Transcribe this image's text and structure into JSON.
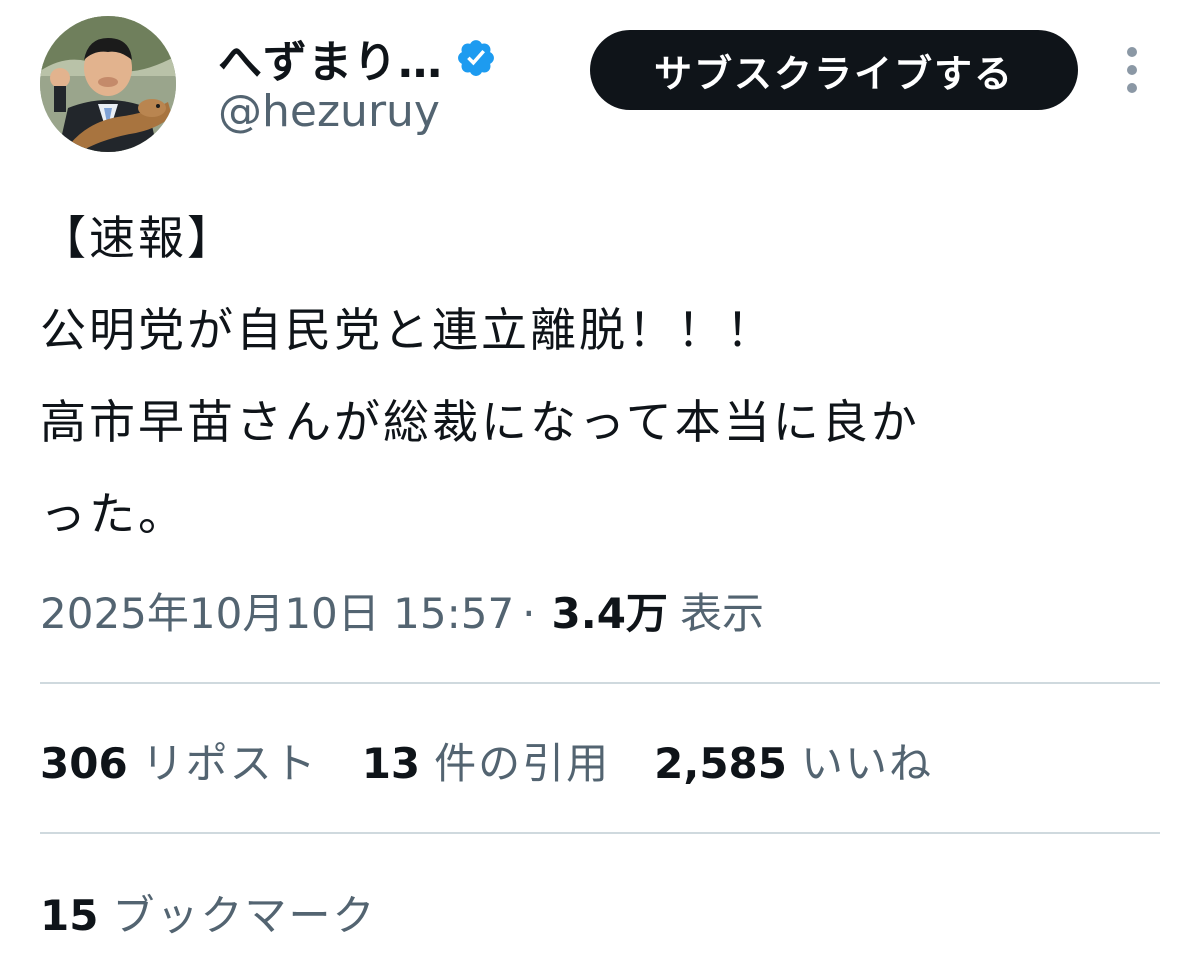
{
  "tweet": {
    "author": {
      "display_name": "へずまり…",
      "handle": "@hezuruy",
      "verified": true,
      "verified_icon": "verified-badge-icon"
    },
    "subscribe_label": "サブスクライブする",
    "more_icon": "more-vertical-icon",
    "text_lines": [
      "【速報】",
      "公明党が自民党と連立離脱！！！",
      "高市早苗さんが総裁になって本当に良か",
      "った。"
    ],
    "timestamp": "2025年10月10日 15:57",
    "separator": "·",
    "views_count": "3.4万",
    "views_label": "表示",
    "stats": [
      {
        "count": "306",
        "label": "リポスト"
      },
      {
        "count": "13",
        "label": "件の引用"
      },
      {
        "count": "2,585",
        "label": "いいね"
      }
    ],
    "bookmarks": {
      "count": "15",
      "label": "ブックマーク"
    }
  },
  "colors": {
    "text_primary": "#0f1419",
    "text_secondary": "#536471",
    "verified_blue": "#1d9bf0",
    "divider": "#cfd9de",
    "button_bg": "#0f1419"
  }
}
